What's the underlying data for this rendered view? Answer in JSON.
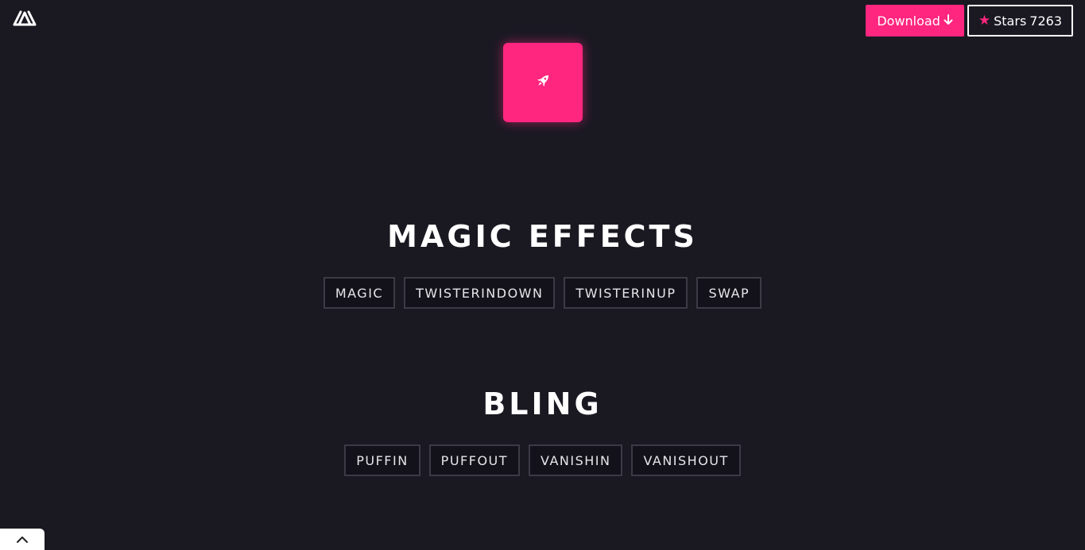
{
  "header": {
    "logo_icon": "triangle-logo-icon",
    "download_label": "Download",
    "download_icon": "arrow-down-icon",
    "stars_icon": "star-icon",
    "stars_label": "Stars",
    "stars_count": "7263"
  },
  "hero": {
    "icon": "rocket-icon"
  },
  "sections": [
    {
      "title": "MAGIC EFFECTS",
      "buttons": [
        "MAGIC",
        "TWISTERINDOWN",
        "TWISTERINUP",
        "SWAP"
      ]
    },
    {
      "title": "BLING",
      "buttons": [
        "PUFFIN",
        "PUFFOUT",
        "VANISHIN",
        "VANISHOUT"
      ]
    }
  ],
  "footer": {
    "scroll_top_icon": "chevron-up-icon"
  },
  "colors": {
    "background": "#1a1922",
    "accent": "#ff267f",
    "button_border": "#3c3b45"
  }
}
